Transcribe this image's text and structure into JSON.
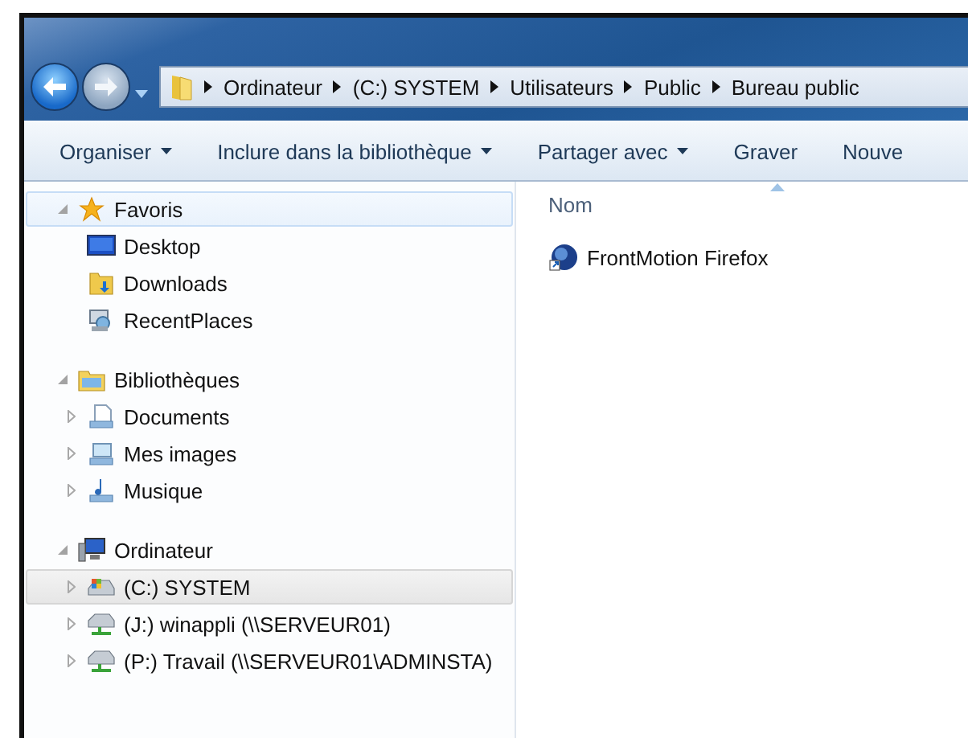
{
  "address_bar": {
    "crumbs": [
      "Ordinateur",
      "(C:) SYSTEM",
      "Utilisateurs",
      "Public",
      "Bureau public"
    ]
  },
  "toolbar": [
    {
      "label": "Organiser",
      "dropdown": true
    },
    {
      "label": "Inclure dans la bibliothèque",
      "dropdown": true
    },
    {
      "label": "Partager avec",
      "dropdown": true
    },
    {
      "label": "Graver",
      "dropdown": false
    },
    {
      "label": "Nouve",
      "dropdown": false
    }
  ],
  "sidebar": {
    "groups": [
      {
        "label": "Favoris",
        "expanded": true,
        "hover": true,
        "children": [
          {
            "label": "Desktop",
            "expandable": false,
            "selected": false
          },
          {
            "label": "Downloads",
            "expandable": false,
            "selected": false
          },
          {
            "label": "RecentPlaces",
            "expandable": false,
            "selected": false
          }
        ]
      },
      {
        "label": "Bibliothèques",
        "expanded": true,
        "hover": false,
        "children": [
          {
            "label": "Documents",
            "expandable": true,
            "selected": false
          },
          {
            "label": "Mes images",
            "expandable": true,
            "selected": false
          },
          {
            "label": "Musique",
            "expandable": true,
            "selected": false
          }
        ]
      },
      {
        "label": "Ordinateur",
        "expanded": true,
        "hover": false,
        "children": [
          {
            "label": "(C:) SYSTEM",
            "expandable": true,
            "selected": true
          },
          {
            "label": "(J:) winappli (\\\\SERVEUR01)",
            "expandable": true,
            "selected": false
          },
          {
            "label": "(P:) Travail (\\\\SERVEUR01\\ADMINSTA)",
            "expandable": true,
            "selected": false
          }
        ]
      }
    ]
  },
  "file_list": {
    "columns": [
      {
        "label": "Nom",
        "sorted": true
      }
    ],
    "items": [
      {
        "name": "FrontMotion Firefox"
      }
    ]
  }
}
